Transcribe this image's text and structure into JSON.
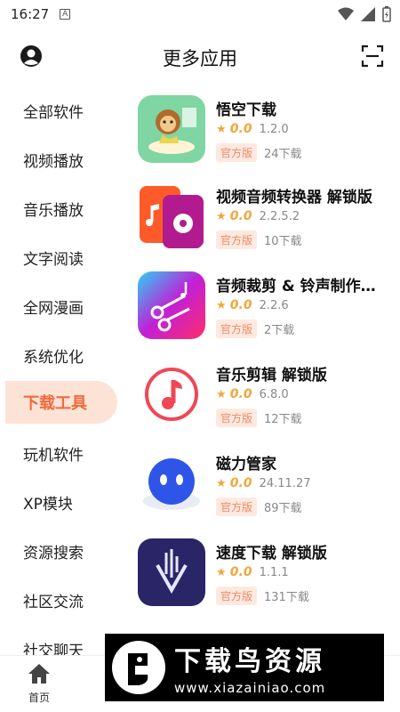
{
  "status_bar": {
    "time": "16:27",
    "app_indicator": "A"
  },
  "header": {
    "title": "更多应用",
    "avatar_icon": "user-avatar-icon",
    "scan_icon": "scan-icon"
  },
  "sidebar": {
    "items": [
      {
        "label": "全部软件",
        "active": false
      },
      {
        "label": "视频播放",
        "active": false
      },
      {
        "label": "音乐播放",
        "active": false
      },
      {
        "label": "文字阅读",
        "active": false
      },
      {
        "label": "全网漫画",
        "active": false
      },
      {
        "label": "系统优化",
        "active": false
      },
      {
        "label": "下载工具",
        "active": true
      },
      {
        "label": "玩机软件",
        "active": false
      },
      {
        "label": "XP模块",
        "active": false
      },
      {
        "label": "资源搜索",
        "active": false
      },
      {
        "label": "社区交流",
        "active": false
      },
      {
        "label": "社交聊天",
        "active": false
      }
    ]
  },
  "apps": [
    {
      "name": "悟空下载",
      "rating": "0.0",
      "version": "1.2.0",
      "badge": "官方版",
      "downloads": "24下载",
      "icon": "monkey-cloud-icon"
    },
    {
      "name": "视频音频转换器 解锁版",
      "rating": "0.0",
      "version": "2.2.5.2",
      "badge": "官方版",
      "downloads": "10下载",
      "icon": "video-audio-convert-icon"
    },
    {
      "name": "音频裁剪 & 铃声制作…",
      "rating": "0.0",
      "version": "2.2.6",
      "badge": "官方版",
      "downloads": "2下载",
      "icon": "scissors-music-icon"
    },
    {
      "name": "音乐剪辑 解锁版",
      "rating": "0.0",
      "version": "6.8.0",
      "badge": "官方版",
      "downloads": "12下载",
      "icon": "music-note-circle-icon"
    },
    {
      "name": "磁力管家",
      "rating": "0.0",
      "version": "24.11.27",
      "badge": "官方版",
      "downloads": "89下载",
      "icon": "robot-face-icon"
    },
    {
      "name": "速度下载 解锁版",
      "rating": "0.0",
      "version": "1.1.1",
      "badge": "官方版",
      "downloads": "131下载",
      "icon": "sound-download-icon"
    }
  ],
  "bottom_nav": {
    "home_label": "首页"
  },
  "watermark": {
    "title": "下载鸟资源",
    "url": "www.xiazainiao.com"
  },
  "colors": {
    "accent": "#f26a3b",
    "active_bg": "#fde3d6",
    "star": "#f4a63a"
  }
}
